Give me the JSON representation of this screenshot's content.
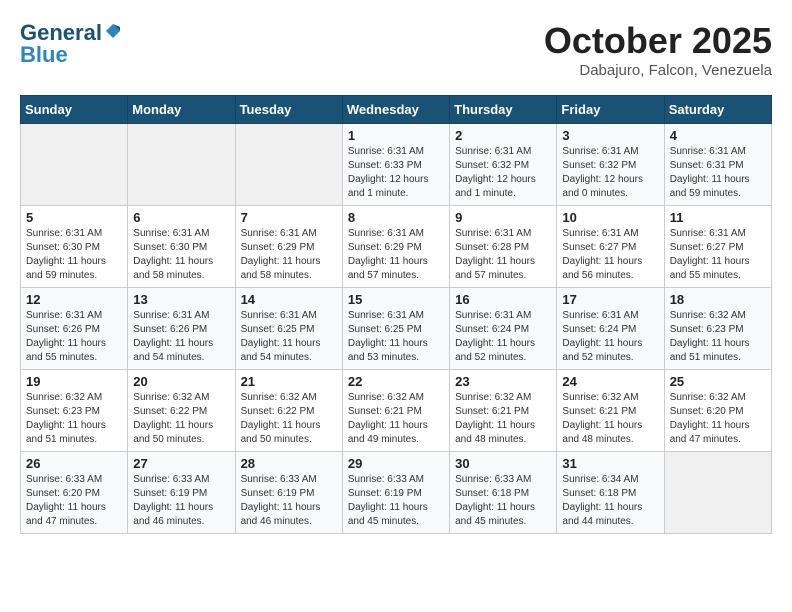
{
  "header": {
    "logo_line1": "General",
    "logo_line2": "Blue",
    "month": "October 2025",
    "location": "Dabajuro, Falcon, Venezuela"
  },
  "weekdays": [
    "Sunday",
    "Monday",
    "Tuesday",
    "Wednesday",
    "Thursday",
    "Friday",
    "Saturday"
  ],
  "weeks": [
    [
      {
        "day": "",
        "info": ""
      },
      {
        "day": "",
        "info": ""
      },
      {
        "day": "",
        "info": ""
      },
      {
        "day": "1",
        "info": "Sunrise: 6:31 AM\nSunset: 6:33 PM\nDaylight: 12 hours\nand 1 minute."
      },
      {
        "day": "2",
        "info": "Sunrise: 6:31 AM\nSunset: 6:32 PM\nDaylight: 12 hours\nand 1 minute."
      },
      {
        "day": "3",
        "info": "Sunrise: 6:31 AM\nSunset: 6:32 PM\nDaylight: 12 hours\nand 0 minutes."
      },
      {
        "day": "4",
        "info": "Sunrise: 6:31 AM\nSunset: 6:31 PM\nDaylight: 11 hours\nand 59 minutes."
      }
    ],
    [
      {
        "day": "5",
        "info": "Sunrise: 6:31 AM\nSunset: 6:30 PM\nDaylight: 11 hours\nand 59 minutes."
      },
      {
        "day": "6",
        "info": "Sunrise: 6:31 AM\nSunset: 6:30 PM\nDaylight: 11 hours\nand 58 minutes."
      },
      {
        "day": "7",
        "info": "Sunrise: 6:31 AM\nSunset: 6:29 PM\nDaylight: 11 hours\nand 58 minutes."
      },
      {
        "day": "8",
        "info": "Sunrise: 6:31 AM\nSunset: 6:29 PM\nDaylight: 11 hours\nand 57 minutes."
      },
      {
        "day": "9",
        "info": "Sunrise: 6:31 AM\nSunset: 6:28 PM\nDaylight: 11 hours\nand 57 minutes."
      },
      {
        "day": "10",
        "info": "Sunrise: 6:31 AM\nSunset: 6:27 PM\nDaylight: 11 hours\nand 56 minutes."
      },
      {
        "day": "11",
        "info": "Sunrise: 6:31 AM\nSunset: 6:27 PM\nDaylight: 11 hours\nand 55 minutes."
      }
    ],
    [
      {
        "day": "12",
        "info": "Sunrise: 6:31 AM\nSunset: 6:26 PM\nDaylight: 11 hours\nand 55 minutes."
      },
      {
        "day": "13",
        "info": "Sunrise: 6:31 AM\nSunset: 6:26 PM\nDaylight: 11 hours\nand 54 minutes."
      },
      {
        "day": "14",
        "info": "Sunrise: 6:31 AM\nSunset: 6:25 PM\nDaylight: 11 hours\nand 54 minutes."
      },
      {
        "day": "15",
        "info": "Sunrise: 6:31 AM\nSunset: 6:25 PM\nDaylight: 11 hours\nand 53 minutes."
      },
      {
        "day": "16",
        "info": "Sunrise: 6:31 AM\nSunset: 6:24 PM\nDaylight: 11 hours\nand 52 minutes."
      },
      {
        "day": "17",
        "info": "Sunrise: 6:31 AM\nSunset: 6:24 PM\nDaylight: 11 hours\nand 52 minutes."
      },
      {
        "day": "18",
        "info": "Sunrise: 6:32 AM\nSunset: 6:23 PM\nDaylight: 11 hours\nand 51 minutes."
      }
    ],
    [
      {
        "day": "19",
        "info": "Sunrise: 6:32 AM\nSunset: 6:23 PM\nDaylight: 11 hours\nand 51 minutes."
      },
      {
        "day": "20",
        "info": "Sunrise: 6:32 AM\nSunset: 6:22 PM\nDaylight: 11 hours\nand 50 minutes."
      },
      {
        "day": "21",
        "info": "Sunrise: 6:32 AM\nSunset: 6:22 PM\nDaylight: 11 hours\nand 50 minutes."
      },
      {
        "day": "22",
        "info": "Sunrise: 6:32 AM\nSunset: 6:21 PM\nDaylight: 11 hours\nand 49 minutes."
      },
      {
        "day": "23",
        "info": "Sunrise: 6:32 AM\nSunset: 6:21 PM\nDaylight: 11 hours\nand 48 minutes."
      },
      {
        "day": "24",
        "info": "Sunrise: 6:32 AM\nSunset: 6:21 PM\nDaylight: 11 hours\nand 48 minutes."
      },
      {
        "day": "25",
        "info": "Sunrise: 6:32 AM\nSunset: 6:20 PM\nDaylight: 11 hours\nand 47 minutes."
      }
    ],
    [
      {
        "day": "26",
        "info": "Sunrise: 6:33 AM\nSunset: 6:20 PM\nDaylight: 11 hours\nand 47 minutes."
      },
      {
        "day": "27",
        "info": "Sunrise: 6:33 AM\nSunset: 6:19 PM\nDaylight: 11 hours\nand 46 minutes."
      },
      {
        "day": "28",
        "info": "Sunrise: 6:33 AM\nSunset: 6:19 PM\nDaylight: 11 hours\nand 46 minutes."
      },
      {
        "day": "29",
        "info": "Sunrise: 6:33 AM\nSunset: 6:19 PM\nDaylight: 11 hours\nand 45 minutes."
      },
      {
        "day": "30",
        "info": "Sunrise: 6:33 AM\nSunset: 6:18 PM\nDaylight: 11 hours\nand 45 minutes."
      },
      {
        "day": "31",
        "info": "Sunrise: 6:34 AM\nSunset: 6:18 PM\nDaylight: 11 hours\nand 44 minutes."
      },
      {
        "day": "",
        "info": ""
      }
    ]
  ]
}
